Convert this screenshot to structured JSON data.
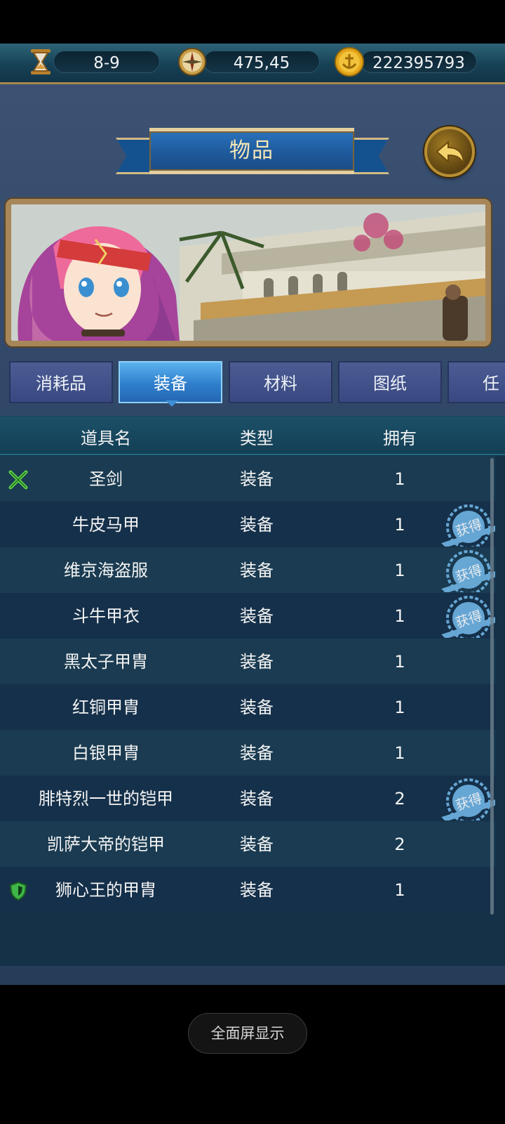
{
  "resources": [
    {
      "icon": "hourglass-icon",
      "value": "8-9"
    },
    {
      "icon": "compass-icon",
      "value": "475,45"
    },
    {
      "icon": "gold-anchor-coin-icon",
      "value": "222395793"
    }
  ],
  "title": "物品",
  "tabs": [
    {
      "label": "消耗品",
      "active": false
    },
    {
      "label": "装备",
      "active": true
    },
    {
      "label": "材料",
      "active": false
    },
    {
      "label": "图纸",
      "active": false
    },
    {
      "label": "任",
      "active": false
    }
  ],
  "table": {
    "headers": {
      "name": "道具名",
      "type": "类型",
      "owned": "拥有"
    },
    "rows": [
      {
        "name": "圣剑",
        "type": "装备",
        "owned": "1",
        "icon": "crossed-swords-icon",
        "stamp": false
      },
      {
        "name": "牛皮马甲",
        "type": "装备",
        "owned": "1",
        "icon": "",
        "stamp": true
      },
      {
        "name": "维京海盗服",
        "type": "装备",
        "owned": "1",
        "icon": "",
        "stamp": true
      },
      {
        "name": "斗牛甲衣",
        "type": "装备",
        "owned": "1",
        "icon": "",
        "stamp": true
      },
      {
        "name": "黑太子甲胄",
        "type": "装备",
        "owned": "1",
        "icon": "",
        "stamp": false
      },
      {
        "name": "红铜甲胄",
        "type": "装备",
        "owned": "1",
        "icon": "",
        "stamp": false
      },
      {
        "name": "白银甲胄",
        "type": "装备",
        "owned": "1",
        "icon": "",
        "stamp": false
      },
      {
        "name": "腓特烈一世的铠甲",
        "type": "装备",
        "owned": "2",
        "icon": "",
        "stamp": true
      },
      {
        "name": "凯萨大帝的铠甲",
        "type": "装备",
        "owned": "2",
        "icon": "",
        "stamp": false
      },
      {
        "name": "狮心王的甲胄",
        "type": "装备",
        "owned": "1",
        "icon": "shield-icon",
        "stamp": false
      }
    ],
    "stamp_text": "获得"
  },
  "system_button": "全面屏显示",
  "colors": {
    "accent": "#2f7fcc",
    "gold": "#b78f34",
    "stamp": "#6fb3e3"
  }
}
